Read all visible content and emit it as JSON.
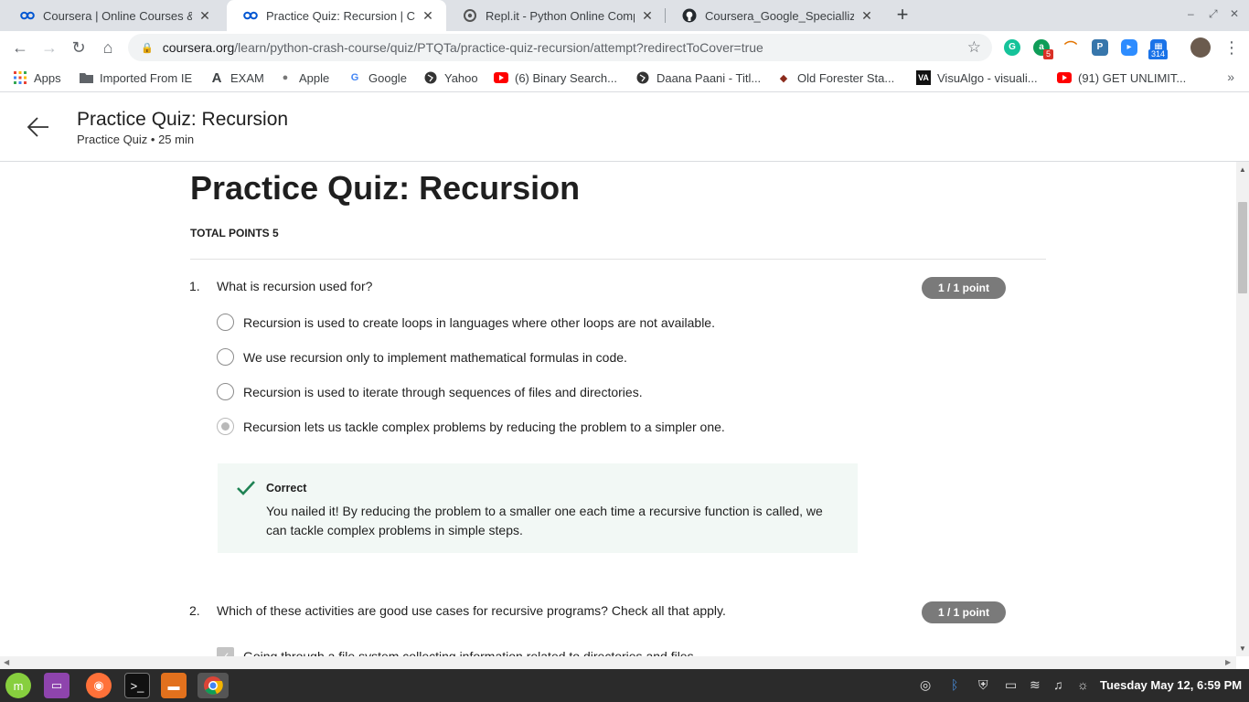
{
  "browser": {
    "tabs": [
      {
        "title": "Coursera | Online Courses & C",
        "favicon": "coursera-icon"
      },
      {
        "title": "Practice Quiz: Recursion | Cou",
        "favicon": "coursera-icon"
      },
      {
        "title": "Repl.it - Python Online Compil",
        "favicon": "replit-icon"
      },
      {
        "title": "Coursera_Google_Speciallizat",
        "favicon": "github-icon"
      }
    ],
    "url_host": "coursera.org",
    "url_path": "/learn/python-crash-course/quiz/PTQTa/practice-quiz-recursion/attempt?redirectToCover=true",
    "extension_badges": {
      "first": "5",
      "second": "314"
    },
    "bookmarks": [
      {
        "label": "Apps",
        "icon": "apps-grid-icon"
      },
      {
        "label": "Imported From IE",
        "icon": "folder-icon"
      },
      {
        "label": "EXAM",
        "icon": "exam-icon"
      },
      {
        "label": "Apple",
        "icon": "apple-icon"
      },
      {
        "label": "Google",
        "icon": "google-icon"
      },
      {
        "label": "Yahoo",
        "icon": "globe-icon"
      },
      {
        "label": "(6) Binary Search...",
        "icon": "youtube-icon"
      },
      {
        "label": "Daana Paani - Titl...",
        "icon": "globe-icon"
      },
      {
        "label": "Old Forester Sta...",
        "icon": "old-forester-icon"
      },
      {
        "label": "VisuAlgo - visuali...",
        "icon": "visualgo-icon"
      },
      {
        "label": "(91) GET UNLIMIT...",
        "icon": "youtube-icon"
      }
    ]
  },
  "header": {
    "title": "Practice Quiz: Recursion",
    "subtitle": "Practice Quiz • 25 min"
  },
  "quiz": {
    "heading": "Practice Quiz: Recursion",
    "total_points": "TOTAL POINTS 5",
    "questions": [
      {
        "number": "1.",
        "text": "What is recursion used for?",
        "points": "1 / 1 point",
        "options": [
          "Recursion is used to create loops in languages where other loops are not available.",
          "We use recursion only to implement mathematical formulas in code.",
          "Recursion is used to iterate through sequences of files and directories.",
          "Recursion lets us tackle complex problems by reducing the problem to a simpler one."
        ],
        "selected_index": 3,
        "feedback": {
          "title": "Correct",
          "text": "You nailed it! By reducing the problem to a smaller one each time a recursive function is called, we can tackle complex problems in simple steps."
        }
      },
      {
        "number": "2.",
        "text": "Which of these activities are good use cases for recursive programs? Check all that apply.",
        "points": "1 / 1 point",
        "options": [
          "Going through a file system collecting information related to directories and files."
        ]
      }
    ]
  },
  "taskbar": {
    "clock": "Tuesday May 12, 6:59 PM"
  },
  "colors": {
    "correct_green": "#1f8354",
    "feedback_bg": "#f2f8f5",
    "points_pill": "#7a7a7a"
  }
}
